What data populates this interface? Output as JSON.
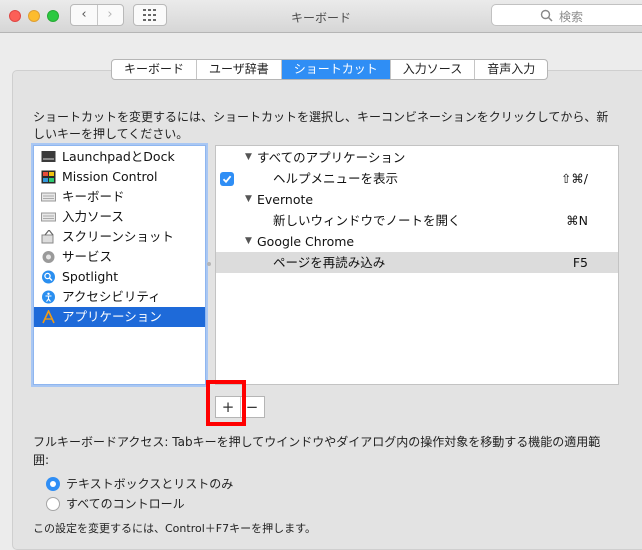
{
  "window": {
    "title": "キーボード"
  },
  "search": {
    "placeholder": "検索"
  },
  "tabs": [
    {
      "label": "キーボード"
    },
    {
      "label": "ユーザ辞書"
    },
    {
      "label": "ショートカット"
    },
    {
      "label": "入力ソース"
    },
    {
      "label": "音声入力"
    }
  ],
  "description": "ショートカットを変更するには、ショートカットを選択し、キーコンビネーションをクリックしてから、新しいキーを押してください。",
  "categories": [
    {
      "label": "LaunchpadとDock",
      "icon": "launchpad-icon"
    },
    {
      "label": "Mission Control",
      "icon": "mission-control-icon"
    },
    {
      "label": "キーボード",
      "icon": "keyboard-icon"
    },
    {
      "label": "入力ソース",
      "icon": "keyboard-icon"
    },
    {
      "label": "スクリーンショット",
      "icon": "screenshot-icon"
    },
    {
      "label": "サービス",
      "icon": "gear-icon"
    },
    {
      "label": "Spotlight",
      "icon": "spotlight-icon"
    },
    {
      "label": "アクセシビリティ",
      "icon": "accessibility-icon"
    },
    {
      "label": "アプリケーション",
      "icon": "app-store-icon",
      "selected": true
    }
  ],
  "shortcuts": {
    "groups": [
      {
        "label": "すべてのアプリケーション"
      },
      {
        "label": "Evernote"
      },
      {
        "label": "Google Chrome"
      }
    ],
    "items": [
      {
        "label": "ヘルプメニューを表示",
        "key": "⇧⌘/",
        "checked": true
      },
      {
        "label": "新しいウィンドウでノートを開く",
        "key": "⌘N"
      },
      {
        "label": "ページを再読み込み",
        "key": "F5",
        "highlighted": true
      }
    ]
  },
  "buttons": {
    "add": "+",
    "remove": "−"
  },
  "full_keyboard_access": {
    "text": "フルキーボードアクセス: Tabキーを押してウインドウやダイアログ内の操作対象を移動する機能の適用範囲:",
    "options": [
      {
        "label": "テキストボックスとリストのみ",
        "selected": true
      },
      {
        "label": "すべてのコントロール",
        "selected": false
      }
    ]
  },
  "note": "この設定を変更するには、Control＋F7キーを押します。",
  "colors": {
    "accent": "#2f8ef5",
    "selection": "#1e6ad9",
    "highlight_box": "#ff0000"
  }
}
